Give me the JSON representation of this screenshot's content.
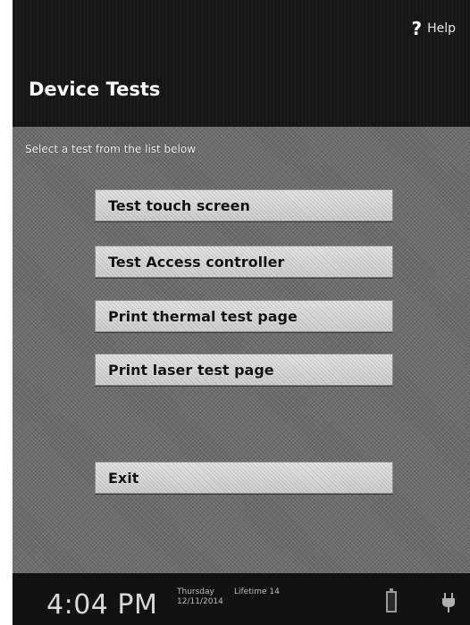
{
  "header": {
    "help_label": "Help",
    "help_icon": "question-mark-icon"
  },
  "page": {
    "title": "Device Tests",
    "instructions": "Select a test from the list below"
  },
  "buttons": {
    "test_touch_screen": "Test touch screen",
    "test_access_controller": "Test Access controller",
    "print_thermal_test_page": "Print thermal test page",
    "print_laser_test_page": "Print laser test page",
    "exit": "Exit"
  },
  "status_bar": {
    "time": "4:04 PM",
    "day": "Thursday",
    "date": "12/11/2014",
    "lifetime": "Lifetime  14",
    "battery_icon": "battery-icon",
    "plug_icon": "power-plug-icon"
  },
  "colors": {
    "screen_background": "#6c6c6c",
    "top_bar": "#161616",
    "button_background": "#d9d9d9",
    "title_text": "#ffffff"
  }
}
